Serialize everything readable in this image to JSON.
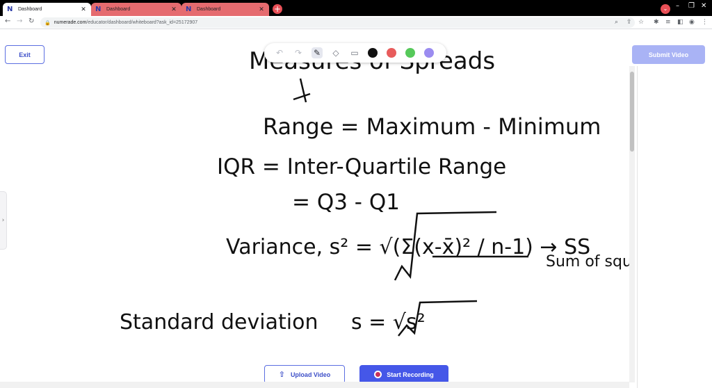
{
  "tabs": [
    {
      "title": "Dashboard",
      "favicon": "N"
    },
    {
      "title": "Dashboard",
      "favicon": "N"
    },
    {
      "title": "Dashboard",
      "favicon": "N"
    }
  ],
  "new_tab_symbol": "+",
  "address_bar": {
    "url_host": "numerade.com",
    "url_path": "/educator/dashboard/whiteboard?ask_id=25172907"
  },
  "page": {
    "exit_label": "Exit",
    "submit_label": "Submit Video",
    "upload_label": "Upload Video",
    "record_label": "Start Recording"
  },
  "whiteboard": {
    "tools": [
      "undo-icon",
      "redo-icon",
      "pen-icon",
      "eraser-icon",
      "image-icon"
    ],
    "colors": [
      "#111111",
      "#e85c5c",
      "#56c95a",
      "#9b8cf0"
    ],
    "handwriting": {
      "line1": "Measures of Spreads",
      "line2": "Range = Maximum - Minimum",
      "line3": "IQR = Inter-Quartile Range",
      "line4": "= Q3 - Q1",
      "line5": "Variance, s² = √(Σ(x-x̄)² / n-1) → SS",
      "line6": "Sum of squa",
      "line7": "Standard deviation",
      "line8": "s = √s²"
    }
  }
}
